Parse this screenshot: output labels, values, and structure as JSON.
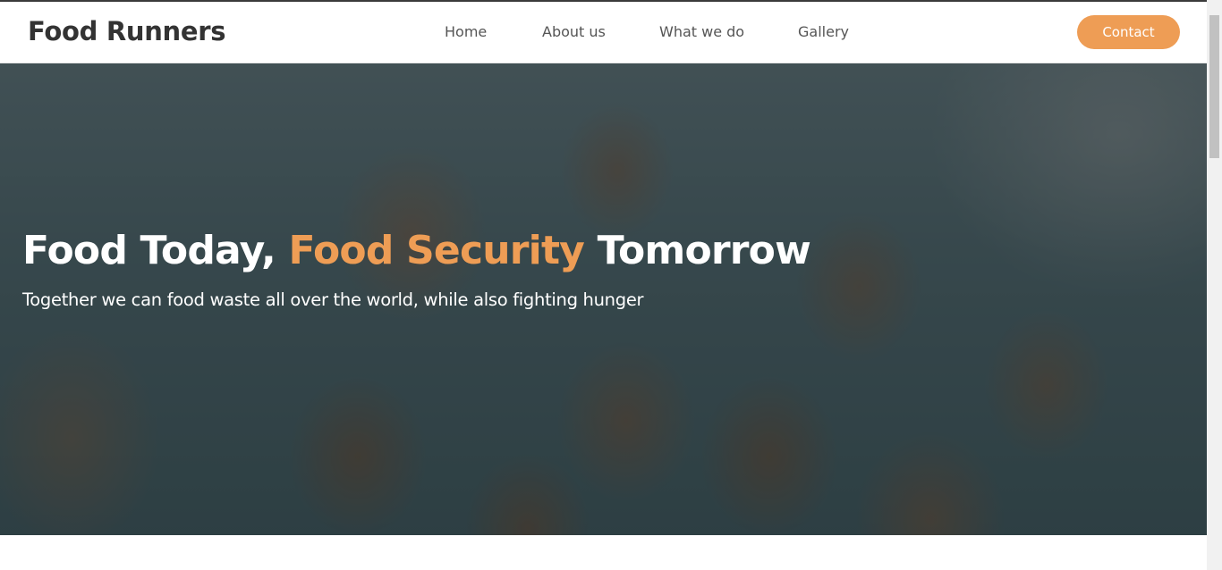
{
  "brand": {
    "name": "Food Runners"
  },
  "nav": {
    "items": [
      {
        "label": "Home"
      },
      {
        "label": "About us"
      },
      {
        "label": "What we do"
      },
      {
        "label": "Gallery"
      }
    ],
    "contact_label": "Contact"
  },
  "hero": {
    "title_part1": "Food Today, ",
    "title_accent": "Food Security",
    "title_part2": " Tomorrow",
    "subtitle": "Together we can food waste all over the world, while also fighting hunger"
  },
  "colors": {
    "accent": "#ee9d55",
    "brand_text": "#333333",
    "nav_text": "#555555"
  }
}
